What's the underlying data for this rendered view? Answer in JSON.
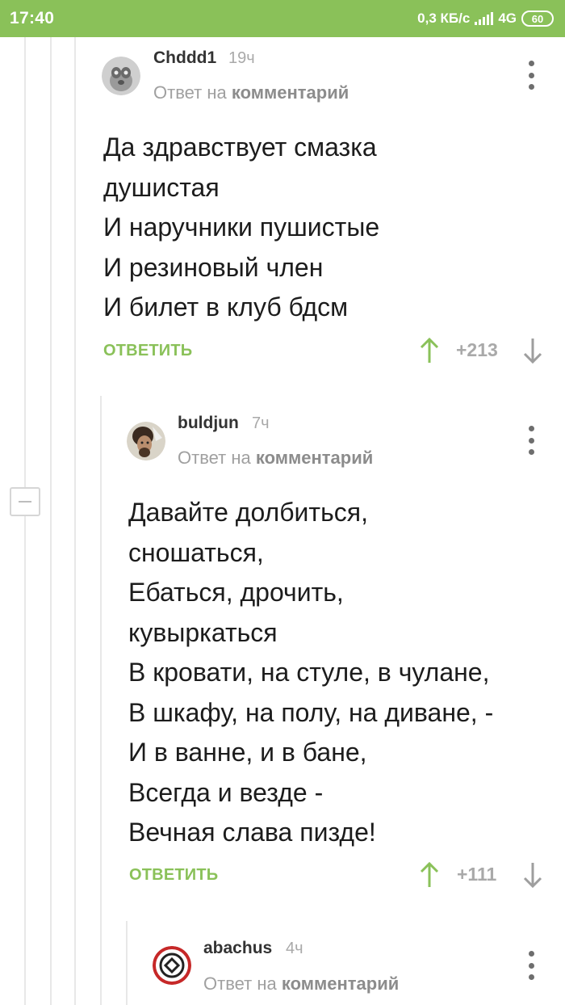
{
  "status_bar": {
    "time": "17:40",
    "speed": "0,3 КБ/с",
    "network": "4G",
    "battery": "60"
  },
  "comments": [
    {
      "username": "Chddd1",
      "time": "19ч",
      "reply_prefix": "Ответ на",
      "reply_target": "комментарий",
      "lines": [
        "Да здравствует смазка",
        "душистая",
        "И наручники пушистые",
        "И резиновый член",
        "И билет в клуб бдсм"
      ],
      "reply_label": "ОТВЕТИТЬ",
      "rating": "+213"
    },
    {
      "username": "buldjun",
      "time": "7ч",
      "reply_prefix": "Ответ на",
      "reply_target": "комментарий",
      "lines": [
        "Давайте долбиться,",
        "сношаться,",
        "Ебаться, дрочить,",
        "кувыркаться",
        "В кровати, на стуле, в чулане,",
        "В шкафу, на полу, на диване, -",
        "И в ванне, и в бане,",
        "Всегда и везде -",
        "Вечная слава пизде!"
      ],
      "reply_label": "ОТВЕТИТЬ",
      "rating": "+111"
    },
    {
      "username": "abachus",
      "time": "4ч",
      "reply_prefix": "Ответ на",
      "reply_target": "комментарий"
    }
  ],
  "colors": {
    "accent": "#8ac159",
    "status_bar": "#8ac159"
  }
}
